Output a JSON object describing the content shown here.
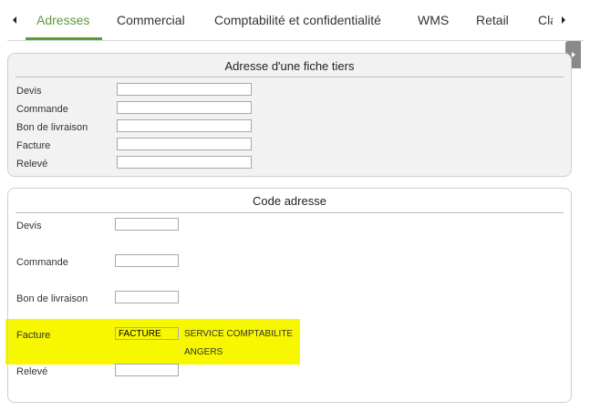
{
  "tabs": [
    {
      "label": "Adresses",
      "active": true
    },
    {
      "label": "Commercial",
      "active": false
    },
    {
      "label": "Comptabilité et confidentialité",
      "active": false
    },
    {
      "label": "WMS",
      "active": false
    },
    {
      "label": "Retail",
      "active": false
    },
    {
      "label": "Cla",
      "active": false
    }
  ],
  "panel_tiers": {
    "title": "Adresse d'une fiche tiers",
    "fields": [
      {
        "label": "Devis",
        "value": ""
      },
      {
        "label": "Commande",
        "value": ""
      },
      {
        "label": "Bon de livraison",
        "value": ""
      },
      {
        "label": "Facture",
        "value": ""
      },
      {
        "label": "Relevé",
        "value": ""
      }
    ]
  },
  "panel_code": {
    "title": "Code adresse",
    "fields": [
      {
        "label": "Devis",
        "value": ""
      },
      {
        "label": "Commande",
        "value": ""
      },
      {
        "label": "Bon de livraison",
        "value": ""
      },
      {
        "label": "Facture",
        "value": "FACTURE",
        "desc_line1": "SERVICE COMPTABILITE",
        "desc_line2": "ANGERS"
      },
      {
        "label": "Relevé",
        "value": ""
      }
    ]
  },
  "colors": {
    "accent": "#5a9a3a",
    "highlight": "#f7f700",
    "panel_bg": "#f2f2f2"
  },
  "icons": {
    "scroll_left": "triangle-left-icon",
    "scroll_right": "triangle-right-icon",
    "side_handle": "triangle-right-icon"
  }
}
